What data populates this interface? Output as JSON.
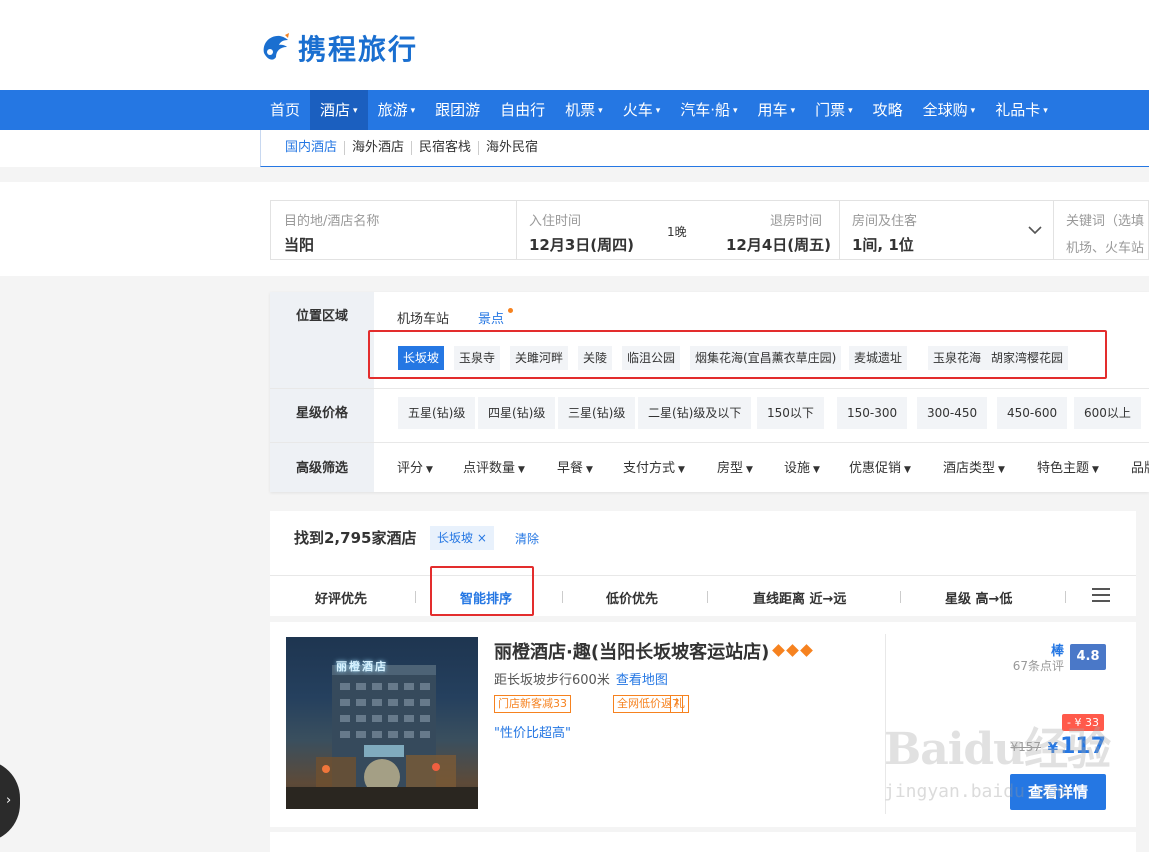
{
  "header": {
    "logo_text": "携程旅行"
  },
  "main_nav": [
    {
      "label": "首页",
      "dropdown": false,
      "active": false
    },
    {
      "label": "酒店",
      "dropdown": true,
      "active": true
    },
    {
      "label": "旅游",
      "dropdown": true,
      "active": false
    },
    {
      "label": "跟团游",
      "dropdown": false,
      "active": false
    },
    {
      "label": "自由行",
      "dropdown": false,
      "active": false
    },
    {
      "label": "机票",
      "dropdown": true,
      "active": false
    },
    {
      "label": "火车",
      "dropdown": true,
      "active": false
    },
    {
      "label": "汽车·船",
      "dropdown": true,
      "active": false
    },
    {
      "label": "用车",
      "dropdown": true,
      "active": false
    },
    {
      "label": "门票",
      "dropdown": true,
      "active": false
    },
    {
      "label": "攻略",
      "dropdown": false,
      "active": false
    },
    {
      "label": "全球购",
      "dropdown": true,
      "active": false
    },
    {
      "label": "礼品卡",
      "dropdown": true,
      "active": false
    }
  ],
  "sub_nav": [
    "国内酒店",
    "海外酒店",
    "民宿客栈",
    "海外民宿"
  ],
  "search": {
    "destination_label": "目的地/酒店名称",
    "destination_value": "当阳",
    "checkin_label": "入住时间",
    "checkin_value": "12月3日(周四)",
    "nights": "1晚",
    "checkout_label": "退房时间",
    "checkout_value": "12月4日(周五)",
    "rooms_label": "房间及住客",
    "rooms_value": "1间, 1位",
    "keyword_label": "关键词（选填",
    "keyword_placeholder": "机场、火车站"
  },
  "filters": {
    "location_label": "位置区域",
    "location_tabs": [
      "机场车站",
      "景点"
    ],
    "attractions": [
      "长坂坡",
      "玉泉寺",
      "关雎河畔",
      "关陵",
      "临沮公园",
      "烟集花海(宜昌薰衣草庄园)",
      "麦城遗址",
      "玉泉花海",
      "胡家湾樱花园"
    ],
    "star_label": "星级价格",
    "star_options": [
      "五星(钻)级",
      "四星(钻)级",
      "三星(钻)级",
      "二星(钻)级及以下",
      "150以下",
      "150-300",
      "300-450",
      "450-600",
      "600以上"
    ],
    "advanced_label": "高级筛选",
    "advanced_options": [
      "评分",
      "点评数量",
      "早餐",
      "支付方式",
      "房型",
      "设施",
      "优惠促销",
      "酒店类型",
      "特色主题",
      "品牌"
    ]
  },
  "results": {
    "found_text": "找到2,795家酒店",
    "active_tag": "长坂坡",
    "tag_close": "×",
    "clear_label": "清除",
    "sort_options": [
      "好评优先",
      "智能排序",
      "低价优先",
      "直线距离 近→远",
      "星级 高→低"
    ]
  },
  "hotel": {
    "name": "丽橙酒店·趣(当阳长坂坡客运站店)",
    "sign_text": "丽橙酒店",
    "distance": "距长坂坡步行600米",
    "map_link": "查看地图",
    "promos": [
      "门店新客减33",
      "全网低价返7",
      "礼"
    ],
    "quote": "\"性价比超高\"",
    "grade": "棒",
    "reviews": "67条点评",
    "score": "4.8",
    "discount": "- ¥ 33",
    "old_price": "¥157",
    "currency": "¥",
    "price": "117",
    "detail_button": "查看详情"
  },
  "watermark": {
    "main": "Baidu经验",
    "sub": "jingyan.baidu.com"
  },
  "colors": {
    "brand_blue": "#2577e3",
    "orange": "#f6821f",
    "red_highlight": "#e32d2d"
  }
}
